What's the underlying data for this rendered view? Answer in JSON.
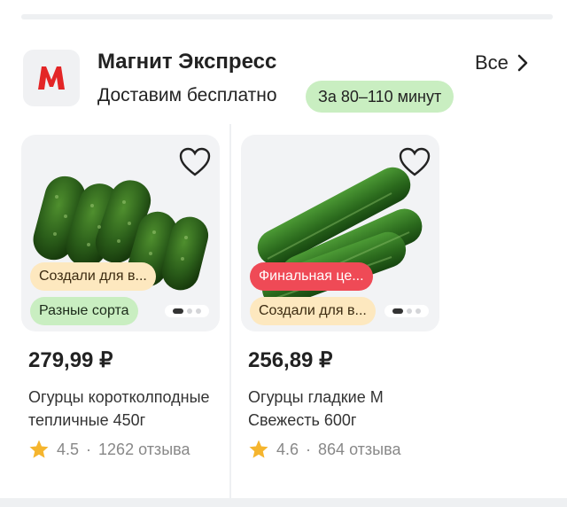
{
  "store": {
    "logo_letter": "M",
    "name": "Магнит Экспресс",
    "delivery": "Доставим бесплатно",
    "time_badge": "За 80–110 минут",
    "all_label": "Все"
  },
  "colors": {
    "brand_red": "#e32526",
    "accent_green": "#c9eec1",
    "accent_orange": "#fde8bf",
    "sale_red": "#ef4a56",
    "star": "#f5b52e"
  },
  "products": [
    {
      "price": "279,99 ₽",
      "title": "Огурцы коротколподные тепличные 450г",
      "rating": "4.5",
      "reviews": "1262 отзыва",
      "separator": "·",
      "badges": [
        "Создали для в...",
        "Разные сорта"
      ]
    },
    {
      "price": "256,89 ₽",
      "title": "Огурцы гладкие М Свежесть 600г",
      "rating": "4.6",
      "reviews": "864 отзыва",
      "separator": "·",
      "badges": [
        "Финальная це...",
        "Создали для в..."
      ]
    }
  ],
  "icons": {
    "favorite": "heart-icon",
    "rating": "star-icon",
    "more": "chevron-right-icon"
  }
}
